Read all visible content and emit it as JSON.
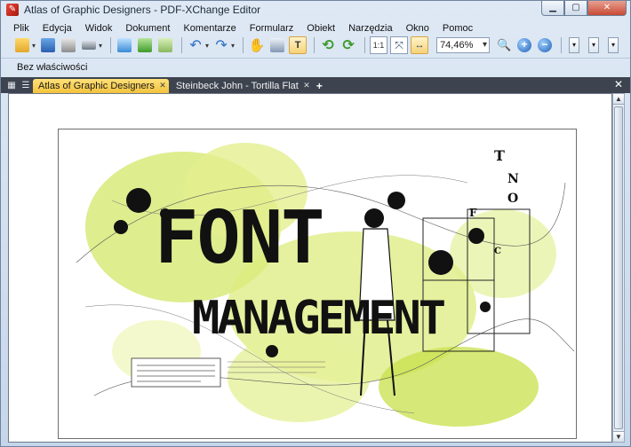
{
  "window": {
    "title": "Atlas of Graphic Designers - PDF-XChange Editor"
  },
  "menu": [
    "Plik",
    "Edycja",
    "Widok",
    "Dokument",
    "Komentarze",
    "Formularz",
    "Obiekt",
    "Narzędzia",
    "Okno",
    "Pomoc"
  ],
  "toolbar": {
    "zoom_value": "74,46%"
  },
  "properties": {
    "label": "Bez właściwości"
  },
  "tabs": [
    {
      "label": "Atlas of Graphic Designers"
    },
    {
      "label": "Steinbeck John - Tortilla Flat"
    }
  ],
  "page": {
    "line1": "FONT",
    "line2": "MANAGEMENT"
  },
  "colors": {
    "accent_tab": "#f3c23d",
    "splash_green": "#c8e04a",
    "title_bg": "#dfe9f5"
  }
}
